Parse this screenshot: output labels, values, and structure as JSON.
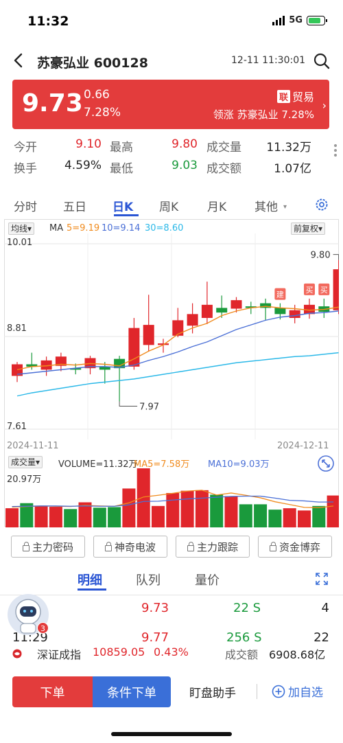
{
  "status_bar": {
    "time": "11:32",
    "network": "5G"
  },
  "header": {
    "title": "苏豪弘业 600128",
    "timestamp": "12-11 11:30:01"
  },
  "quote": {
    "price": "9.73",
    "change": "0.66",
    "change_pct": "7.28%",
    "tag_badge": "联",
    "tag_label": "贸易",
    "lead_text": "领涨 苏豪弘业 7.28%"
  },
  "stats": [
    {
      "label": "今开",
      "value": "9.10",
      "color": "up"
    },
    {
      "label": "最高",
      "value": "9.80",
      "color": "up"
    },
    {
      "label": "成交量",
      "value": "11.32万",
      "color": "dark"
    },
    {
      "label": "换手",
      "value": "4.59%",
      "color": "dark"
    },
    {
      "label": "最低",
      "value": "9.03",
      "color": "down"
    },
    {
      "label": "成交额",
      "value": "1.07亿",
      "color": "dark"
    }
  ],
  "tabs": [
    "分时",
    "五日",
    "日K",
    "周K",
    "月K",
    "其他"
  ],
  "active_tab": "日K",
  "chart_data": {
    "type": "candlestick",
    "ma_selector": "均线",
    "ma_label": "MA",
    "ma_values": [
      {
        "label": "5=9.19",
        "color": "#f08a1c"
      },
      {
        "label": "10=9.14",
        "color": "#4a6fd6"
      },
      {
        "label": "30=8.60",
        "color": "#2ab8e8"
      }
    ],
    "adjust_selector": "前复权",
    "y_labels": [
      "10.01",
      "8.81",
      "7.61"
    ],
    "ylim": [
      7.61,
      10.01
    ],
    "max_marker": "9.80",
    "min_marker": "7.97",
    "date_start": "2024-11-11",
    "date_end": "2024-12-11",
    "buy_marks": [
      "建",
      "买",
      "买"
    ],
    "candles": [
      {
        "o": 8.3,
        "c": 8.45,
        "h": 8.48,
        "l": 8.22
      },
      {
        "o": 8.45,
        "c": 8.42,
        "h": 8.6,
        "l": 8.38
      },
      {
        "o": 8.38,
        "c": 8.5,
        "h": 8.55,
        "l": 8.3
      },
      {
        "o": 8.43,
        "c": 8.55,
        "h": 8.6,
        "l": 8.36
      },
      {
        "o": 8.4,
        "c": 8.38,
        "h": 8.46,
        "l": 8.32
      },
      {
        "o": 8.4,
        "c": 8.53,
        "h": 8.56,
        "l": 8.32
      },
      {
        "o": 8.42,
        "c": 8.38,
        "h": 8.48,
        "l": 8.2
      },
      {
        "o": 8.52,
        "c": 8.4,
        "h": 8.56,
        "l": 7.97
      },
      {
        "o": 8.42,
        "c": 8.92,
        "h": 9.05,
        "l": 8.38
      },
      {
        "o": 8.7,
        "c": 8.96,
        "h": 9.35,
        "l": 8.62
      },
      {
        "o": 8.7,
        "c": 8.72,
        "h": 8.78,
        "l": 8.6
      },
      {
        "o": 8.82,
        "c": 9.02,
        "h": 9.18,
        "l": 8.8
      },
      {
        "o": 8.95,
        "c": 9.1,
        "h": 9.24,
        "l": 8.85
      },
      {
        "o": 9.05,
        "c": 9.22,
        "h": 9.52,
        "l": 8.97
      },
      {
        "o": 9.18,
        "c": 9.12,
        "h": 9.34,
        "l": 9.05
      },
      {
        "o": 9.17,
        "c": 9.28,
        "h": 9.32,
        "l": 9.12
      },
      {
        "o": 9.2,
        "c": 9.18,
        "h": 9.26,
        "l": 9.1
      },
      {
        "o": 9.24,
        "c": 9.18,
        "h": 9.3,
        "l": 9.02
      },
      {
        "o": 9.18,
        "c": 9.1,
        "h": 9.24,
        "l": 9.03
      },
      {
        "o": 9.05,
        "c": 9.15,
        "h": 9.22,
        "l": 8.98
      },
      {
        "o": 9.1,
        "c": 9.22,
        "h": 9.3,
        "l": 9.04
      },
      {
        "o": 9.2,
        "c": 9.13,
        "h": 9.3,
        "l": 9.05
      },
      {
        "o": 9.15,
        "c": 9.68,
        "h": 9.8,
        "l": 9.1
      }
    ],
    "ma5": [
      8.38,
      8.42,
      8.43,
      8.45,
      8.44,
      8.46,
      8.45,
      8.43,
      8.52,
      8.62,
      8.7,
      8.84,
      8.92,
      8.98,
      9.08,
      9.14,
      9.18,
      9.2,
      9.18,
      9.17,
      9.15,
      9.16,
      9.19
    ],
    "ma10": [
      8.32,
      8.34,
      8.36,
      8.38,
      8.4,
      8.42,
      8.42,
      8.41,
      8.44,
      8.5,
      8.55,
      8.61,
      8.68,
      8.74,
      8.82,
      8.9,
      8.96,
      9.02,
      9.06,
      9.08,
      9.11,
      9.12,
      9.14
    ],
    "ma30": [
      8.04,
      8.08,
      8.11,
      8.14,
      8.17,
      8.2,
      8.22,
      8.24,
      8.26,
      8.29,
      8.32,
      8.35,
      8.38,
      8.41,
      8.44,
      8.47,
      8.49,
      8.51,
      8.53,
      8.55,
      8.56,
      8.58,
      8.6
    ]
  },
  "volume_data": {
    "selector": "成交量",
    "volume_label": "VOLUME=11.32万",
    "ma5_label": "MA5=7.58万",
    "ma10_label": "MA10=9.03万",
    "max_label": "20.97万",
    "max_value": 20.97,
    "values": [
      6.8,
      8.6,
      7.7,
      7.3,
      6.5,
      8.9,
      7.0,
      7.2,
      13.8,
      20.97,
      7.6,
      12.2,
      13.0,
      13.2,
      11.6,
      11.1,
      8.2,
      8.2,
      6.3,
      6.8,
      6.0,
      7.6,
      11.32
    ],
    "ma5": [
      7.2,
      7.4,
      7.6,
      7.5,
      7.4,
      7.8,
      7.6,
      7.5,
      8.7,
      10.8,
      11.4,
      12.1,
      12.9,
      13.2,
      11.5,
      12.2,
      11.4,
      10.5,
      9.1,
      8.1,
      7.1,
      7.0,
      7.58
    ],
    "ma10": [
      7.4,
      7.5,
      7.6,
      7.6,
      7.5,
      7.6,
      7.5,
      7.5,
      8.0,
      9.2,
      9.3,
      9.7,
      10.1,
      10.4,
      10.7,
      11.0,
      11.1,
      11.1,
      10.4,
      9.6,
      9.4,
      9.0,
      9.03
    ]
  },
  "features": [
    "主力密码",
    "神奇电波",
    "主力跟踪",
    "资金博弈"
  ],
  "detail_tabs": [
    "明细",
    "队列",
    "量价"
  ],
  "trades": [
    {
      "time": "",
      "price": "9.73",
      "volume": "22 S",
      "count": "4"
    },
    {
      "time": "11:29",
      "price": "9.77",
      "volume": "256 S",
      "count": "22"
    }
  ],
  "avatar_badge": "3",
  "index_bar": {
    "name": "深证成指",
    "value": "10859.05",
    "pct": "0.43%",
    "turnover_label": "成交额",
    "turnover": "6908.68亿"
  },
  "actions": {
    "order": "下单",
    "conditional": "条件下单",
    "monitor": "盯盘助手",
    "add_watch": "加自选"
  }
}
